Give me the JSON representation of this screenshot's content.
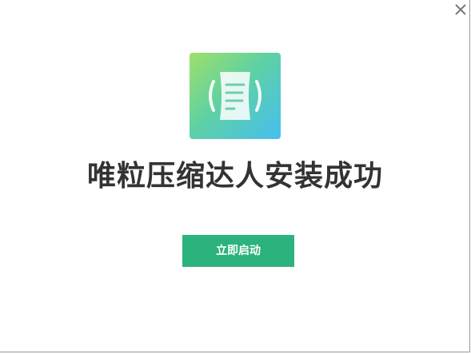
{
  "window": {
    "close_icon": "close-icon"
  },
  "logo": {
    "icon": "scroll-compress-icon",
    "gradient_start": "#9ee06a",
    "gradient_end": "#45bff0"
  },
  "main": {
    "headline": "唯粒压缩达人安装成功",
    "launch_button_label": "立即启动",
    "accent_color": "#2cb27c"
  }
}
